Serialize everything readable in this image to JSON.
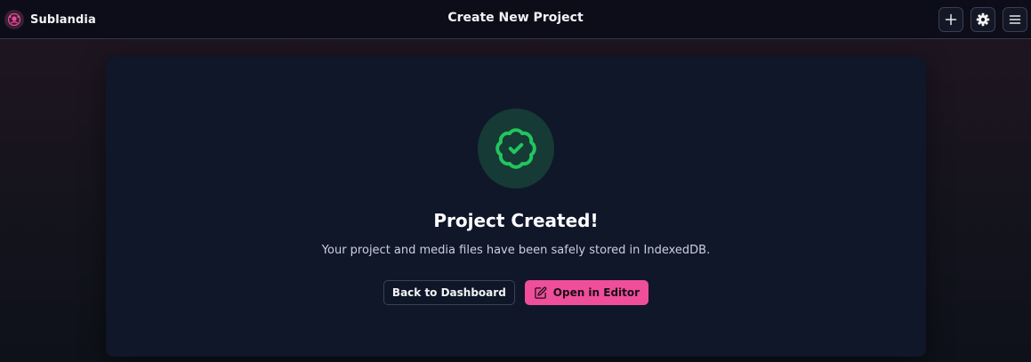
{
  "app": {
    "name": "Sublandia",
    "logo_icon": "brand-logo-icon"
  },
  "header": {
    "title": "Create New Project",
    "actions": [
      {
        "icon": "plus-icon"
      },
      {
        "icon": "gear-icon"
      },
      {
        "icon": "menu-icon"
      }
    ]
  },
  "success": {
    "icon": "badge-check-icon",
    "title": "Project Created!",
    "description": "Your project and media files have been safely stored in IndexedDB.",
    "back_label": "Back to Dashboard",
    "open_label": "Open in Editor",
    "open_icon": "edit-icon"
  },
  "colors": {
    "accent": "#ef4e9b",
    "success": "#22c55e",
    "card_bg": "#101729"
  }
}
